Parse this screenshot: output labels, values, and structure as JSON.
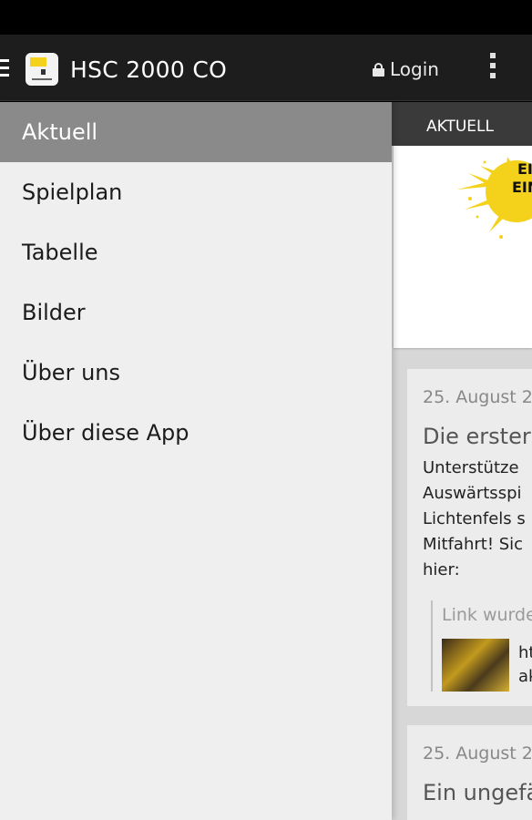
{
  "actionbar": {
    "title": "HSC 2000 CO",
    "login_label": "Login"
  },
  "tabs": [
    {
      "label": "AKTUELL"
    }
  ],
  "banner": {
    "text": "EI\nEIN"
  },
  "drawer": {
    "items": [
      {
        "label": "Aktuell",
        "active": true
      },
      {
        "label": "Spielplan",
        "active": false
      },
      {
        "label": "Tabelle",
        "active": false
      },
      {
        "label": "Bilder",
        "active": false
      },
      {
        "label": "Über uns",
        "active": false
      },
      {
        "label": "Über diese App",
        "active": false
      }
    ]
  },
  "feed": [
    {
      "date": "25. August 2",
      "title": "Die erster",
      "text_lines": [
        "Unterstütze",
        "Auswärtsspi",
        "Lichtenfels s",
        "Mitfahrt! Sic",
        "hier:"
      ],
      "link": {
        "label": "Link wurde",
        "url_lines": [
          "ht",
          "ak"
        ]
      }
    },
    {
      "date": "25. August 2",
      "title": "Ein ungefä"
    }
  ],
  "colors": {
    "actionbar_bg": "#1d1d1d",
    "drawer_bg": "#efefef",
    "drawer_active": "#8a8a8a",
    "brand_yellow": "#f4d21c"
  },
  "icons": [
    "hamburger-icon",
    "app-logo",
    "lock-icon",
    "overflow-menu-icon"
  ]
}
